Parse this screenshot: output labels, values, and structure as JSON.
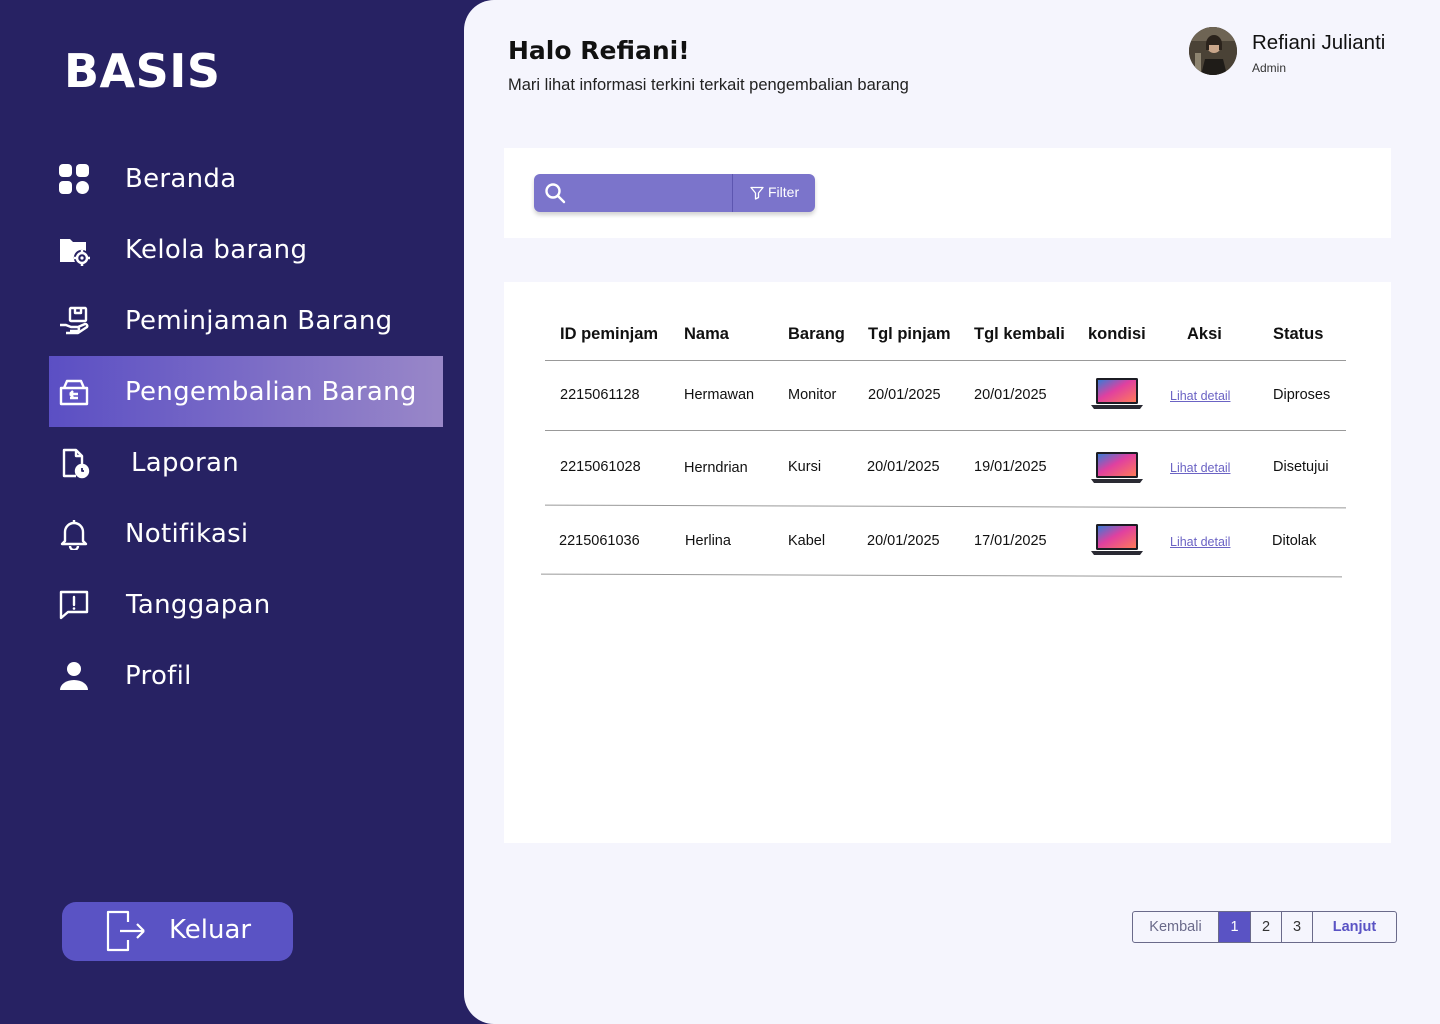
{
  "app": {
    "logo": "BASIS"
  },
  "sidebar": {
    "items": [
      {
        "label": "Beranda",
        "icon": "dashboard-icon"
      },
      {
        "label": "Kelola barang",
        "icon": "folder-settings-icon"
      },
      {
        "label": "Peminjaman Barang",
        "icon": "hand-box-icon"
      },
      {
        "label": "Pengembalian Barang",
        "icon": "return-box-icon",
        "active": true
      },
      {
        "label": "Laporan",
        "icon": "report-icon"
      },
      {
        "label": "Notifikasi",
        "icon": "bell-icon"
      },
      {
        "label": "Tanggapan",
        "icon": "feedback-icon"
      },
      {
        "label": "Profil",
        "icon": "user-icon"
      }
    ],
    "logout_label": "Keluar"
  },
  "header": {
    "greeting": "Halo Refiani!",
    "subtitle": "Mari lihat informasi terkini terkait pengembalian barang",
    "user_name": "Refiani Julianti",
    "user_role": "Admin"
  },
  "search": {
    "placeholder": "",
    "filter_label": "Filter"
  },
  "table": {
    "columns": [
      "ID peminjam",
      "Nama",
      "Barang",
      "Tgl pinjam",
      "Tgl kembali",
      "kondisi",
      "Aksi",
      "Status"
    ],
    "rows": [
      {
        "id": "2215061128",
        "nama": "Hermawan",
        "barang": "Monitor",
        "tgl_pinjam": "20/01/2025",
        "tgl_kembali": "20/01/2025",
        "kondisi": "laptop-image",
        "aksi": "Lihat detail",
        "status": "Diproses"
      },
      {
        "id": "2215061028",
        "nama": "Herndrian",
        "barang": "Kursi",
        "tgl_pinjam": "20/01/2025",
        "tgl_kembali": "19/01/2025",
        "kondisi": "laptop-image",
        "aksi": "Lihat detail",
        "status": "Disetujui"
      },
      {
        "id": "2215061036",
        "nama": "Herlina",
        "barang": "Kabel",
        "tgl_pinjam": "20/01/2025",
        "tgl_kembali": "17/01/2025",
        "kondisi": "laptop-image",
        "aksi": "Lihat detail",
        "status": "Ditolak"
      }
    ]
  },
  "pagination": {
    "prev_label": "Kembali",
    "pages": [
      "1",
      "2",
      "3"
    ],
    "current": "1",
    "next_label": "Lanjut"
  },
  "colors": {
    "sidebar_bg": "#272263",
    "accent": "#5a53c4",
    "main_bg": "#f5f5fd",
    "search_bg": "#7b74cb"
  }
}
